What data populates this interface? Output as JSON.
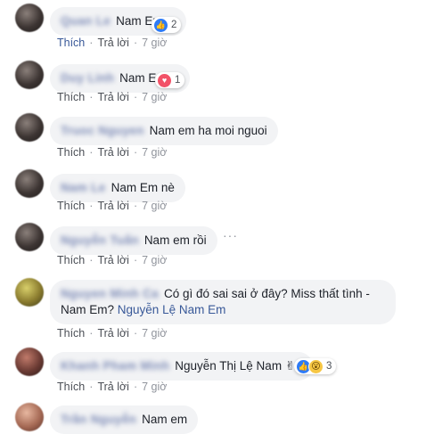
{
  "actions": {
    "like": "Thích",
    "reply": "Trả lời",
    "sep": "·"
  },
  "comments": [
    {
      "author": "Quan Le",
      "text": "Nam Em",
      "time": "7 giờ",
      "reaction_count": "2"
    },
    {
      "author": "Duy Linh",
      "text": "Nam Em",
      "time": "7 giờ",
      "reaction_count": "1"
    },
    {
      "author": "Truoc Nguyen",
      "text": "Nam em ha moi nguoi",
      "time": "7 giờ"
    },
    {
      "author": "Nam Le",
      "text": "Nam Em nè",
      "time": "7 giờ"
    },
    {
      "author": "Nguyễn Tuấn",
      "text": "Nam em rồi",
      "time": "7 giờ"
    },
    {
      "author": "Nguyen Minh Ca",
      "text": "Có gì đó sai sai ở đây? Miss thất tình - Nam Em?",
      "mention": "Nguyễn Lệ Nam Em",
      "time": "7 giờ"
    },
    {
      "author": "Khanh Pham Minh",
      "text": "Nguyễn Thị Lệ Nam ✌",
      "time": "7 giờ",
      "reaction_count": "3"
    },
    {
      "author": "Trần Nguyễn",
      "text": "Nam em"
    }
  ],
  "more_glyph": "···"
}
